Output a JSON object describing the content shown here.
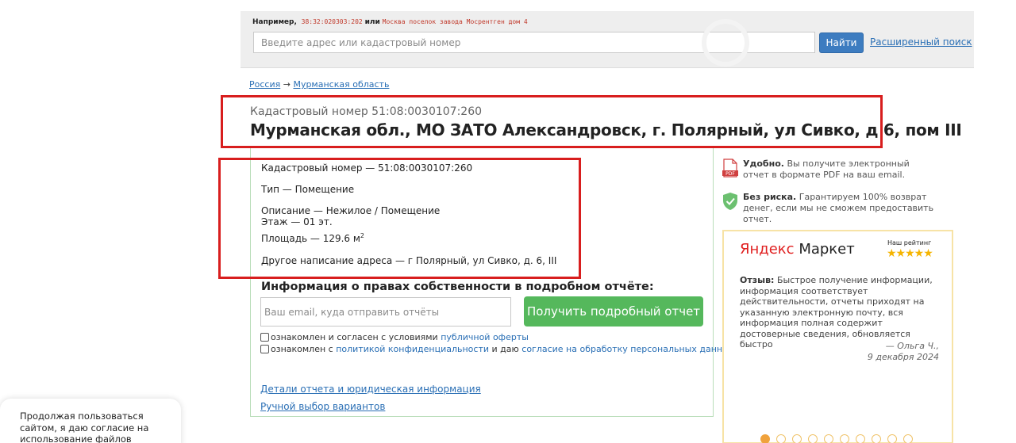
{
  "search": {
    "example_prefix": "Например,",
    "example_code": "38:32:020303:202",
    "example_or": "или",
    "example_address": "Москва поселок завода Мосрентген дом 4",
    "placeholder": "Введите адрес или кадастровый номер",
    "button_label": "Найти",
    "advanced_label": "Расширенный поиск"
  },
  "breadcrumb": {
    "items": [
      "Россия",
      "Мурманская область"
    ],
    "separator": "→"
  },
  "header": {
    "subtitle": "Кадастровый номер 51:08:0030107:260",
    "title": "Мурманская обл., МО ЗАТО Александровск, г. Полярный, ул Сивко, д 6, пом III"
  },
  "details": {
    "cadastral": "Кадастровый номер — 51:08:0030107:260",
    "type": "Тип — Помещение",
    "description": "Описание — Нежилое / Помещение",
    "floor": "Этаж — 01 эт.",
    "area": "Площадь — 129.6 м",
    "area_sup": "2",
    "alt_address": "Другое написание адреса — г Полярный, ул Сивко, д. 6, III"
  },
  "report": {
    "heading": "Информация о правах собственности в подробном отчёте:",
    "email_placeholder": "Ваш email, куда отправить отчёты",
    "button_label": "Получить подробный отчет",
    "consent1_text": "ознакомлен и согласен с условиями",
    "consent1_link": "публичной оферты",
    "consent2_text": "ознакомлен с",
    "consent2_link1": "политикой конфиденциальности",
    "consent2_and": "и даю",
    "consent2_link2": "согласие на обработку персональных данных",
    "link_details": "Детали отчета и юридическая информация",
    "link_manual": "Ручной выбор вариантов"
  },
  "benefits": [
    {
      "icon": "pdf-icon",
      "bold": "Удобно.",
      "text": "Вы получите электронный отчет в формате PDF на ваш email."
    },
    {
      "icon": "shield-check-icon",
      "bold": "Без риска.",
      "text": "Гарантируем 100% возврат денег, если мы не сможем предоставить отчет."
    }
  ],
  "review": {
    "brand_part1": "Яндекс",
    "brand_part2": "Маркет",
    "rating_label": "Наш рейтинг",
    "stars": "★★★★★",
    "label": "Отзыв:",
    "text": "Быстрое получение информации, информация соответствует действительности, отчеты приходят на указанную электронную почту, вся информация полная содержит достоверные сведения, обновляется быстро",
    "author": "— Ольга Ч.,",
    "date": "9 декабря 2024"
  },
  "cookie": {
    "text": "Продолжая пользоваться сайтом, я даю согласие на использование файлов"
  },
  "colors": {
    "accent_blue": "#3d7cc0",
    "link": "#2a6fb5",
    "highlight_red": "#d81e1e",
    "cta_green": "#55b85c",
    "star": "#f5b400"
  }
}
